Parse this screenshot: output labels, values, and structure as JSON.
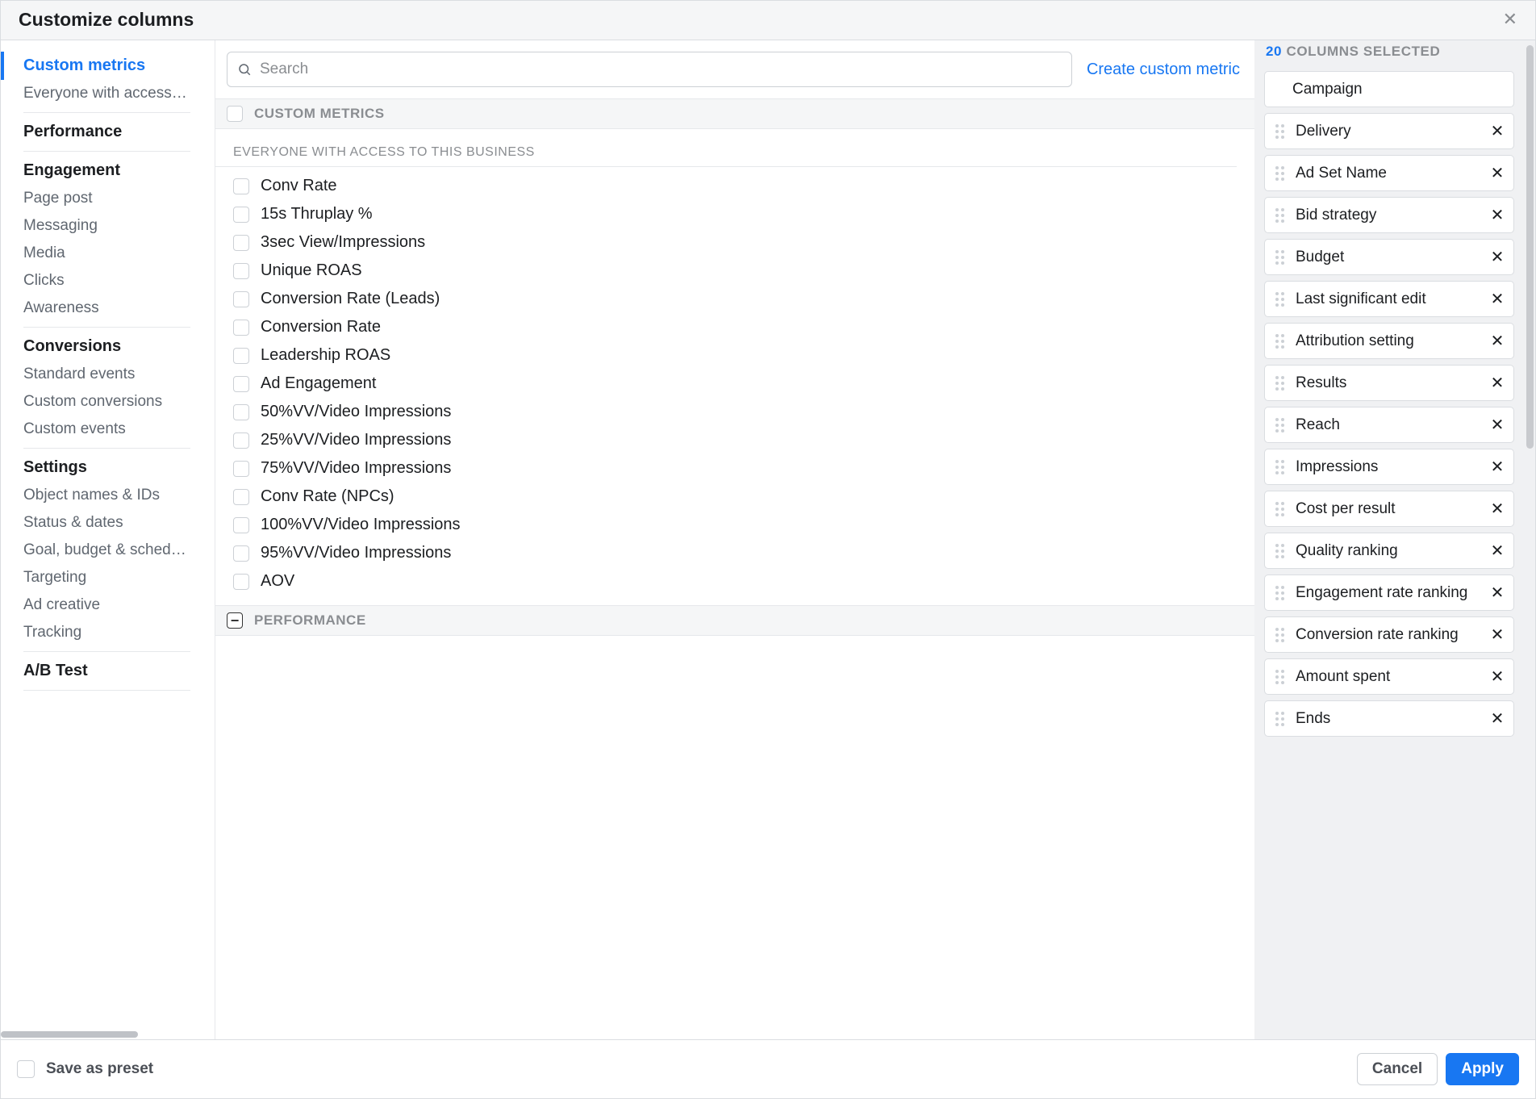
{
  "header": {
    "title": "Customize columns"
  },
  "sidebar": {
    "groups": [
      {
        "heading": "Custom metrics",
        "active": true,
        "items": [
          {
            "label": "Everyone with access to this Business"
          }
        ]
      },
      {
        "heading": "Performance",
        "items": []
      },
      {
        "heading": "Engagement",
        "items": [
          {
            "label": "Page post"
          },
          {
            "label": "Messaging"
          },
          {
            "label": "Media"
          },
          {
            "label": "Clicks"
          },
          {
            "label": "Awareness"
          }
        ]
      },
      {
        "heading": "Conversions",
        "items": [
          {
            "label": "Standard events"
          },
          {
            "label": "Custom conversions"
          },
          {
            "label": "Custom events"
          }
        ]
      },
      {
        "heading": "Settings",
        "items": [
          {
            "label": "Object names & IDs"
          },
          {
            "label": "Status & dates"
          },
          {
            "label": "Goal, budget & schedule"
          },
          {
            "label": "Targeting"
          },
          {
            "label": "Ad creative"
          },
          {
            "label": "Tracking"
          }
        ]
      },
      {
        "heading": "A/B Test",
        "items": []
      }
    ]
  },
  "center": {
    "search_placeholder": "Search",
    "create_link": "Create custom metric",
    "sections": [
      {
        "title": "CUSTOM METRICS",
        "check_state": "unchecked",
        "subgroup_title": "EVERYONE WITH ACCESS TO THIS BUSINESS",
        "metrics": [
          "Conv Rate",
          "15s Thruplay %",
          "3sec View/Impressions",
          "Unique ROAS",
          "Conversion Rate (Leads)",
          "Conversion Rate",
          "Leadership ROAS",
          "Ad Engagement",
          "50%VV/Video Impressions",
          "25%VV/Video Impressions",
          "75%VV/Video Impressions",
          "Conv Rate (NPCs)",
          "100%VV/Video Impressions",
          "95%VV/Video Impressions",
          "AOV"
        ]
      },
      {
        "title": "PERFORMANCE",
        "check_state": "indeterminate",
        "metrics": []
      }
    ]
  },
  "right": {
    "count": "20",
    "suffix": "COLUMNS SELECTED",
    "columns": [
      {
        "label": "Campaign",
        "locked": true
      },
      {
        "label": "Delivery"
      },
      {
        "label": "Ad Set Name"
      },
      {
        "label": "Bid strategy"
      },
      {
        "label": "Budget"
      },
      {
        "label": "Last significant edit"
      },
      {
        "label": "Attribution setting"
      },
      {
        "label": "Results"
      },
      {
        "label": "Reach"
      },
      {
        "label": "Impressions"
      },
      {
        "label": "Cost per result"
      },
      {
        "label": "Quality ranking"
      },
      {
        "label": "Engagement rate ranking"
      },
      {
        "label": "Conversion rate ranking"
      },
      {
        "label": "Amount spent"
      },
      {
        "label": "Ends"
      }
    ]
  },
  "footer": {
    "save_preset": "Save as preset",
    "cancel": "Cancel",
    "apply": "Apply"
  }
}
